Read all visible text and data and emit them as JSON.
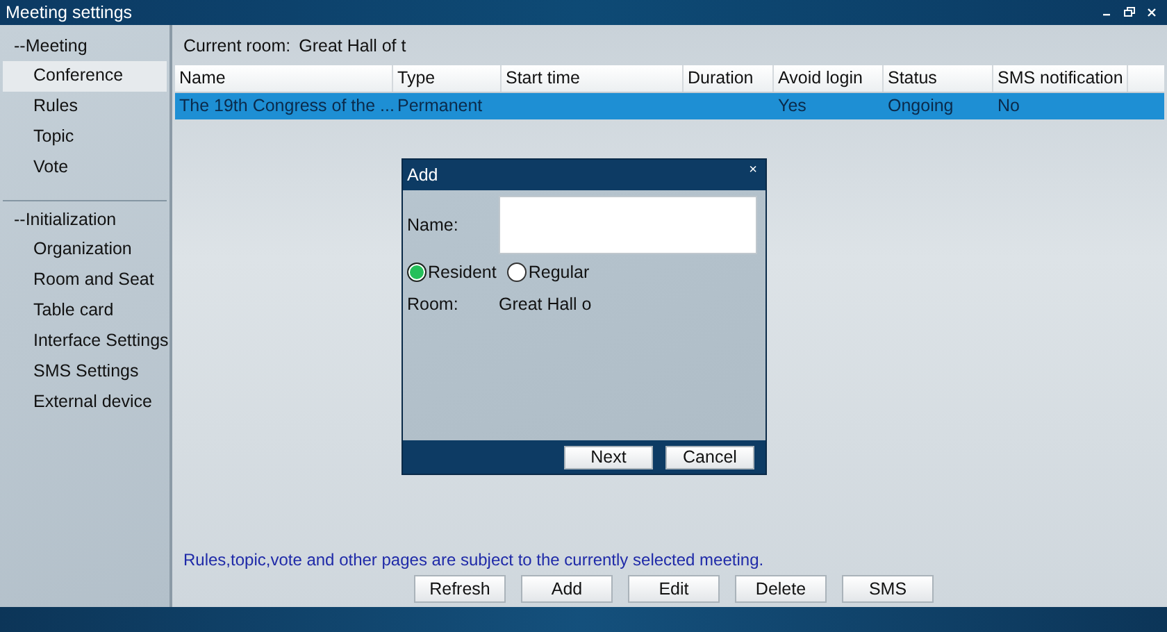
{
  "window": {
    "title": "Meeting settings"
  },
  "sidebar": {
    "groups": [
      {
        "label": "--Meeting",
        "items": [
          {
            "label": "Conference",
            "selected": true
          },
          {
            "label": "Rules",
            "selected": false
          },
          {
            "label": "Topic",
            "selected": false
          },
          {
            "label": "Vote",
            "selected": false
          }
        ]
      },
      {
        "label": "--Initialization",
        "items": [
          {
            "label": "Organization",
            "selected": false
          },
          {
            "label": "Room and Seat",
            "selected": false
          },
          {
            "label": "Table card",
            "selected": false
          },
          {
            "label": "Interface Settings",
            "selected": false
          },
          {
            "label": "SMS Settings",
            "selected": false
          },
          {
            "label": "External device",
            "selected": false
          }
        ]
      }
    ]
  },
  "current_room": {
    "label": "Current room:",
    "value": "Great Hall of t"
  },
  "table": {
    "columns": [
      "Name",
      "Type",
      "Start time",
      "Duration",
      "Avoid login",
      "Status",
      "SMS notification"
    ],
    "rows": [
      {
        "selected": true,
        "cells": [
          "The 19th Congress of the ...",
          "Permanent",
          "",
          "",
          "Yes",
          "Ongoing",
          "No"
        ]
      }
    ]
  },
  "dialog": {
    "title": "Add",
    "close": "×",
    "name_label": "Name:",
    "options": [
      {
        "label": "Resident",
        "selected": true
      },
      {
        "label": "Regular",
        "selected": false
      }
    ],
    "room_label": "Room:",
    "room_value": "Great Hall o",
    "buttons": [
      "Next",
      "Cancel"
    ]
  },
  "notice": "Rules,topic,vote and other pages are subject to the currently selected meeting.",
  "buttons": [
    "Refresh",
    "Add",
    "Edit",
    "Delete",
    "SMS"
  ]
}
